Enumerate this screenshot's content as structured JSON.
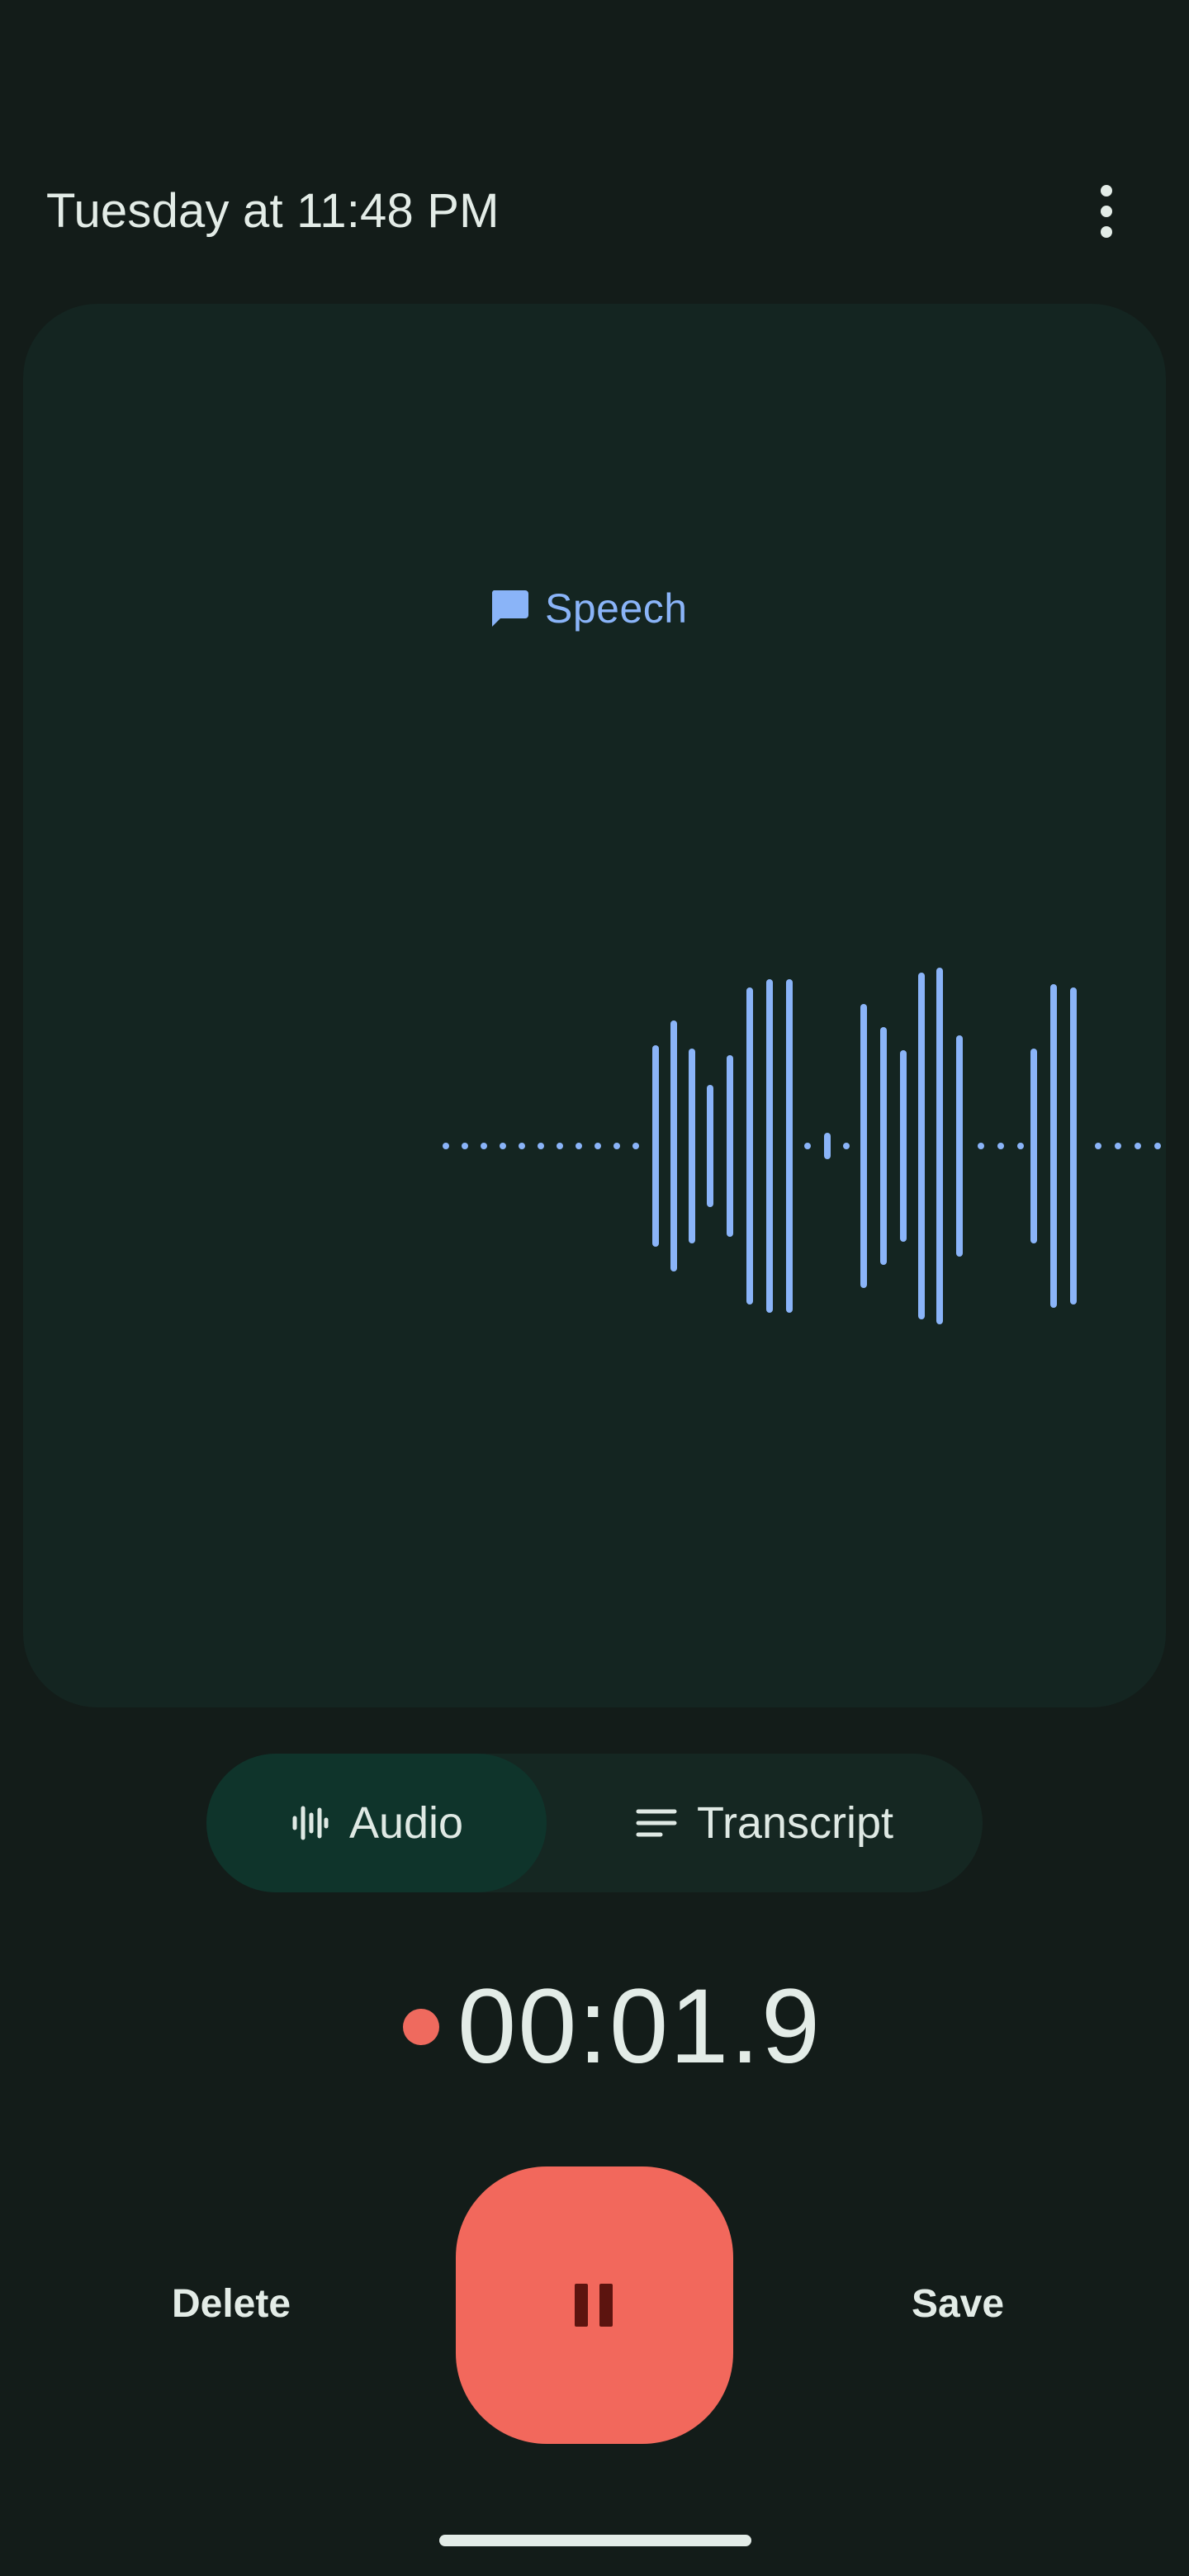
{
  "header": {
    "title": "Tuesday at 11:48 PM",
    "more_icon": "more-vert-icon"
  },
  "waveform_card": {
    "speech_label": "Speech",
    "speech_icon": "chat-bubble-icon",
    "wave_color": "#8ab4f8"
  },
  "mode_toggle": {
    "audio_label": "Audio",
    "audio_icon": "waveform-icon",
    "transcript_label": "Transcript",
    "transcript_icon": "lines-icon",
    "selected": "Audio"
  },
  "recording": {
    "time": "00:01.9",
    "indicator_color": "#ef6a5e"
  },
  "controls": {
    "delete_label": "Delete",
    "save_label": "Save",
    "pause_icon": "pause-icon",
    "pause_color": "#f2685c"
  }
}
